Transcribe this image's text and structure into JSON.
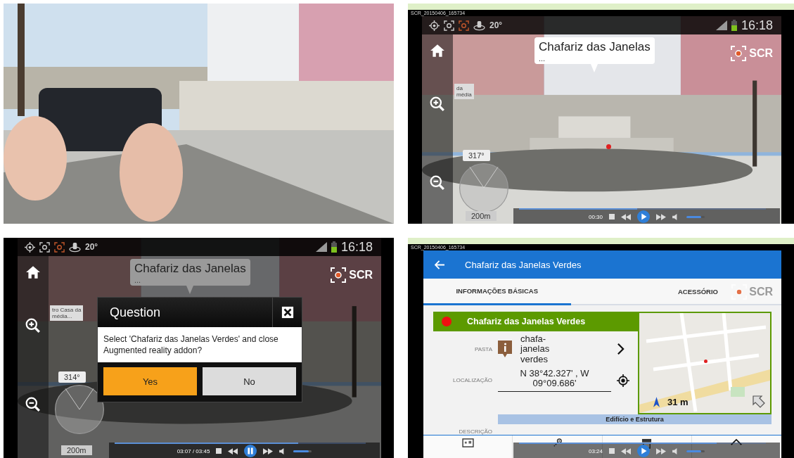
{
  "ar_view": {
    "window_file": "SCR_20150406_165734",
    "status_bar": {
      "tilt": "20°",
      "time": "16:18"
    },
    "poi_callout": {
      "title": "Chafariz das Janelas",
      "more": "..."
    },
    "side_callout": {
      "lines": [
        "da",
        "média"
      ]
    },
    "heading": "317°",
    "range": "200m",
    "record_badge": "SCR",
    "player": {
      "time": "00:30",
      "playing": false,
      "level": 0.48,
      "volume": {
        "level": 0.8
      }
    }
  },
  "question_view": {
    "status_bar": {
      "tilt": "20°",
      "time": "16:18"
    },
    "poi_callout": {
      "title": "Chafariz das Janelas",
      "more": "..."
    },
    "side_callout": {
      "lines": [
        "tro Casa da",
        "média..."
      ]
    },
    "heading": "314°",
    "range": "200m",
    "record_badge": "SCR",
    "dialog": {
      "title": "Question",
      "message": "Select 'Chafariz das Janelas Verdes' and close Augmented reality addon?",
      "buttons": [
        {
          "label": "Yes",
          "selected": true
        },
        {
          "label": "No",
          "selected": false
        }
      ]
    },
    "player": {
      "time": "03:07 / 03:45",
      "playing": true,
      "level": 0.73,
      "volume": {
        "level": 0.85
      }
    }
  },
  "detail_view": {
    "window_file": "SCR_20150406_165734",
    "header": {
      "title": "Chafariz das Janelas Verdes"
    },
    "tabs": [
      {
        "label": "INFORMAÇÕES BÁSICAS",
        "selected": true
      },
      {
        "label": "ACESSÓRIO",
        "selected": false
      }
    ],
    "record_badge": "SCR",
    "card": {
      "title": "Chafariz das Janelas Verdes",
      "fields": [
        {
          "kind": "folder",
          "label": "PASTA",
          "value": "chafa-janelas verdes"
        },
        {
          "kind": "location",
          "label": "LOCALIZAÇÃO",
          "value": "N 38°42.327' , W 09°09.686'"
        },
        {
          "kind": "text",
          "label": "DESCRIÇÃO"
        }
      ],
      "map": {
        "distance": "31 m"
      },
      "category": "Edifício e Estrutura"
    },
    "player": {
      "time": "03:24",
      "playing": false,
      "level": 0.8,
      "volume": {
        "level": 0.8
      }
    }
  }
}
